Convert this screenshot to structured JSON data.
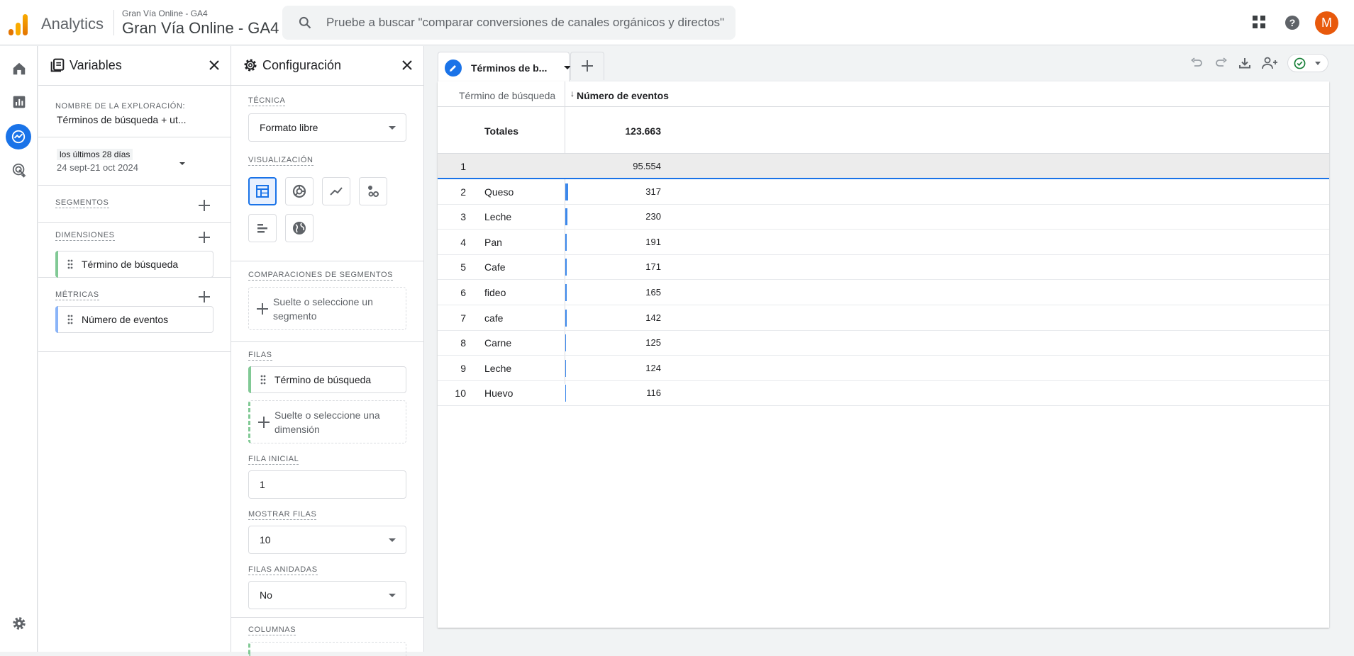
{
  "topbar": {
    "app_name": "Analytics",
    "property_small": "Gran Vía Online - GA4",
    "property_big": "Gran Vía Online - GA4",
    "search_placeholder": "Pruebe a buscar \"comparar conversiones de canales orgánicos y directos\"",
    "avatar_letter": "M",
    "icons": [
      "apps-grid-icon",
      "help-icon"
    ]
  },
  "rail": {
    "icons": [
      "home-icon",
      "reports-icon",
      "explore-icon",
      "advertising-icon",
      "settings-icon"
    ],
    "active": "explore-icon"
  },
  "variables": {
    "title": "Variables",
    "exploration_label": "NOMBRE DE LA EXPLORACIÓN:",
    "exploration_name": "Términos de búsqueda + ut...",
    "date_badge": "los últimos 28 días",
    "date_range": "24 sept-21 oct 2024",
    "segments_label": "SEGMENTOS",
    "dimensions_label": "DIMENSIONES",
    "dimension_item": "Término de búsqueda",
    "metrics_label": "MÉTRICAS",
    "metric_item": "Número de eventos"
  },
  "config": {
    "title": "Configuración",
    "technique_label": "TÉCNICA",
    "technique_value": "Formato libre",
    "viz_label": "VISUALIZACIÓN",
    "viz_options": [
      "table-icon",
      "donut-chart-icon",
      "line-chart-icon",
      "scatter-icon",
      "bar-chart-icon",
      "geo-map-icon"
    ],
    "viz_selected": "table-icon",
    "segment_compare_label": "COMPARACIONES DE SEGMENTOS",
    "segment_drop": "Suelte o seleccione un segmento",
    "rows_label": "FILAS",
    "row_item": "Término de búsqueda",
    "row_drop": "Suelte o seleccione una dimensión",
    "start_row_label": "FILA INICIAL",
    "start_row_value": "1",
    "show_rows_label": "MOSTRAR FILAS",
    "show_rows_value": "10",
    "nested_rows_label": "FILAS ANIDADAS",
    "nested_rows_value": "No",
    "columns_label": "COLUMNAS"
  },
  "tab": {
    "label": "Términos de b..."
  },
  "toolbar": {
    "icons": [
      "undo-icon",
      "redo-icon",
      "download-icon",
      "share-icon",
      "check-status-icon"
    ]
  },
  "table": {
    "dimension_header": "Término de búsqueda",
    "metric_header": "Número de eventos",
    "sort_indicator": "↓",
    "totals_label": "Totales",
    "totals_value": "123.663",
    "rows": [
      {
        "n": "1",
        "term": "",
        "value": "95.554",
        "raw": 95554
      },
      {
        "n": "2",
        "term": "Queso",
        "value": "317",
        "raw": 317
      },
      {
        "n": "3",
        "term": "Leche",
        "value": "230",
        "raw": 230
      },
      {
        "n": "4",
        "term": "Pan",
        "value": "191",
        "raw": 191
      },
      {
        "n": "5",
        "term": "Cafe",
        "value": "171",
        "raw": 171
      },
      {
        "n": "6",
        "term": "fideo",
        "value": "165",
        "raw": 165
      },
      {
        "n": "7",
        "term": "cafe",
        "value": "142",
        "raw": 142
      },
      {
        "n": "8",
        "term": "Carne",
        "value": "125",
        "raw": 125
      },
      {
        "n": "9",
        "term": "Leche",
        "value": "124",
        "raw": 124
      },
      {
        "n": "10",
        "term": "Huevo",
        "value": "116",
        "raw": 116
      }
    ]
  }
}
